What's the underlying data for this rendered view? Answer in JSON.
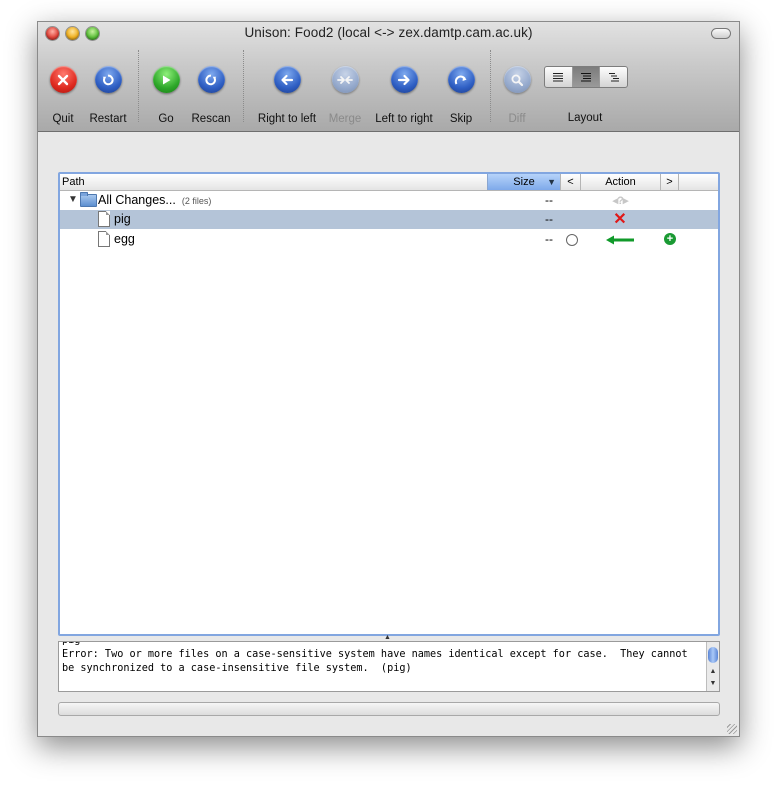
{
  "window": {
    "title": "Unison: Food2 (local <-> zex.damtp.cam.ac.uk)"
  },
  "toolbar": {
    "buttons": [
      {
        "label": "Quit",
        "icon": "x-icon",
        "color": "#df2a20"
      },
      {
        "label": "Restart",
        "icon": "restart-icon",
        "color": "#2f5fc4"
      },
      {
        "label": "Go",
        "icon": "play-icon",
        "color": "#2ea82a"
      },
      {
        "label": "Rescan",
        "icon": "rescan-icon",
        "color": "#2f5fc4"
      },
      {
        "label": "Right to left",
        "icon": "arrow-left-icon",
        "color": "#2f5fc4"
      },
      {
        "label": "Merge",
        "icon": "merge-icon",
        "color": "#8ea6cf"
      },
      {
        "label": "Left to right",
        "icon": "arrow-right-icon",
        "color": "#2f5fc4"
      },
      {
        "label": "Skip",
        "icon": "skip-icon",
        "color": "#2f5fc4"
      },
      {
        "label": "Diff",
        "icon": "magnifier-icon",
        "color": "#8ea6cf"
      }
    ],
    "layout_label": "Layout"
  },
  "table": {
    "columns": {
      "path": "Path",
      "size": "Size",
      "left": "<",
      "action": "Action",
      "right": ">"
    },
    "rows": [
      {
        "name": "All Changes...",
        "note": "(2 files)",
        "size": "--",
        "action": "unknown"
      },
      {
        "name": "pig",
        "size": "--",
        "action": "conflict"
      },
      {
        "name": "egg",
        "size": "--",
        "action": "right-to-left"
      }
    ]
  },
  "details": {
    "text": "pig\nError: Two or more files on a case-sensitive system have names identical except for case.  They cannot be synchronized to a case-insensitive file system.  (pig)"
  }
}
